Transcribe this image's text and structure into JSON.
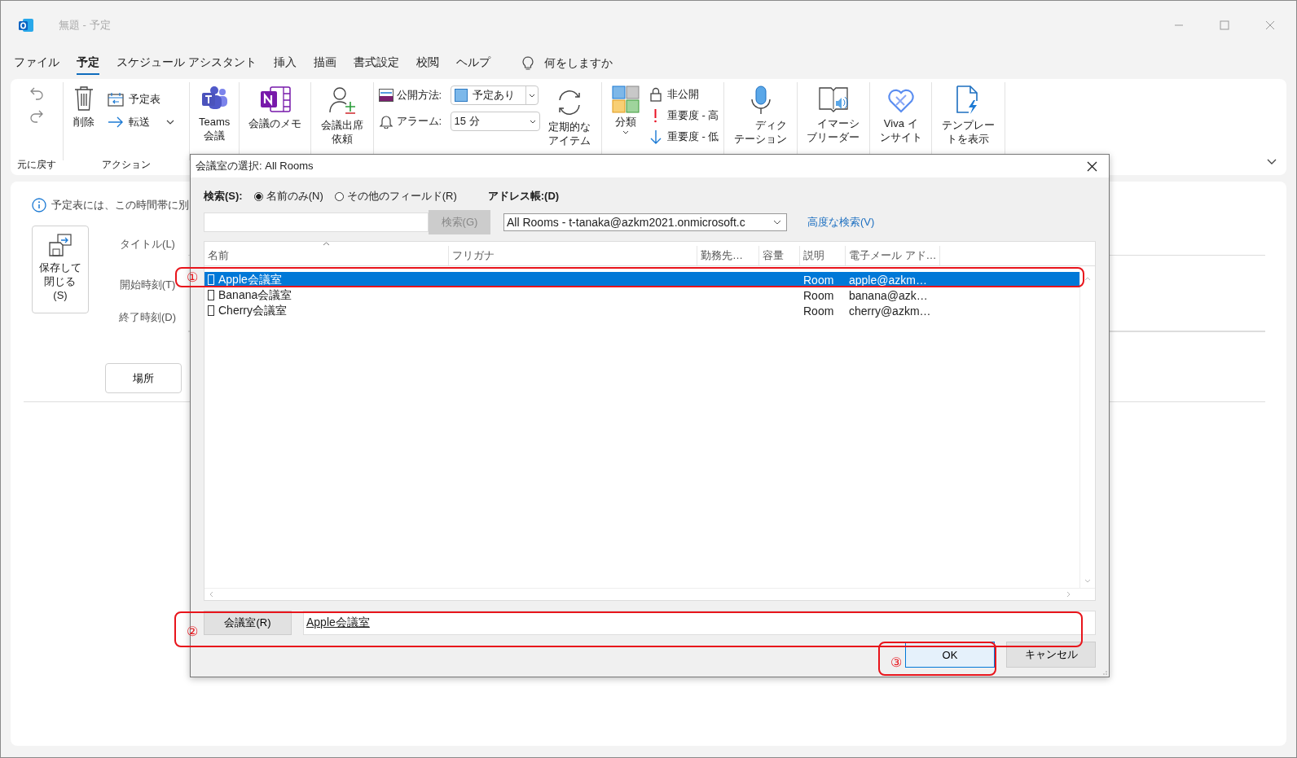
{
  "window": {
    "title": "無題 - 予定"
  },
  "menu": [
    {
      "label": "ファイル",
      "selected": false
    },
    {
      "label": "予定",
      "selected": true
    },
    {
      "label": "スケジュール アシスタント",
      "selected": false
    },
    {
      "label": "挿入",
      "selected": false
    },
    {
      "label": "描画",
      "selected": false
    },
    {
      "label": "書式設定",
      "selected": false
    },
    {
      "label": "校閲",
      "selected": false
    },
    {
      "label": "ヘルプ",
      "selected": false
    }
  ],
  "tell_me": "何をしますか",
  "ribbon": {
    "undo_group": "元に戻す",
    "action_group": "アクション",
    "delete": "削除",
    "calendar": "予定表",
    "forward": "転送",
    "teams": "Teams\n会議",
    "onenote": "会議のメモ",
    "meeting_request": "会議出席依頼",
    "show_as_label": "公開方法:",
    "show_as_value": "予定あり",
    "reminder_label": "アラーム:",
    "reminder_value": "15 分",
    "recurrence": "定期的なアイテム",
    "categorize": "分類",
    "private": "非公開",
    "high_importance": "重要度 - 高",
    "low_importance": "重要度 - 低",
    "dictate": "ディクテーション",
    "immersive_reader": "イマーシブリーダー",
    "viva": "Viva インサイト",
    "templates": "テンプレートを表示"
  },
  "form": {
    "info": "予定表には、この時間帯に別",
    "save_button": "保存して閉じる(S)",
    "title_label": "タイトル(L)",
    "start_label": "開始時刻(T)",
    "end_label": "終了時刻(D)",
    "location_button": "場所"
  },
  "dialog": {
    "title": "会議室の選択: All Rooms",
    "search_label": "検索(S):",
    "search_options": [
      {
        "label": "名前のみ(N)",
        "selected": true
      },
      {
        "label": "その他のフィールド(R)",
        "selected": false
      }
    ],
    "address_book_label": "アドレス帳:(D)",
    "search_button": {
      "label": "検索(G)",
      "disabled": true
    },
    "address_book": "All Rooms - t-tanaka@azkm2021.onmicrosoft.c",
    "advanced_search": "高度な検索(V)",
    "columns": [
      "名前",
      "フリガナ",
      "勤務先…",
      "容量",
      "説明",
      "電子メール アド…"
    ],
    "rows": [
      {
        "name": "Apple会議室",
        "description": "Room",
        "email": "apple@azkm…",
        "selected": true
      },
      {
        "name": "Banana会議室",
        "description": "Room",
        "email": "banana@azk…",
        "selected": false
      },
      {
        "name": "Cherry会議室",
        "description": "Room",
        "email": "cherry@azkm…",
        "selected": false
      }
    ],
    "room_button": "会議室(R)",
    "room_value": "Apple会議室",
    "ok": "OK",
    "cancel": "キャンセル"
  },
  "annotations": [
    {
      "label": "①"
    },
    {
      "label": "②"
    },
    {
      "label": "③"
    }
  ]
}
